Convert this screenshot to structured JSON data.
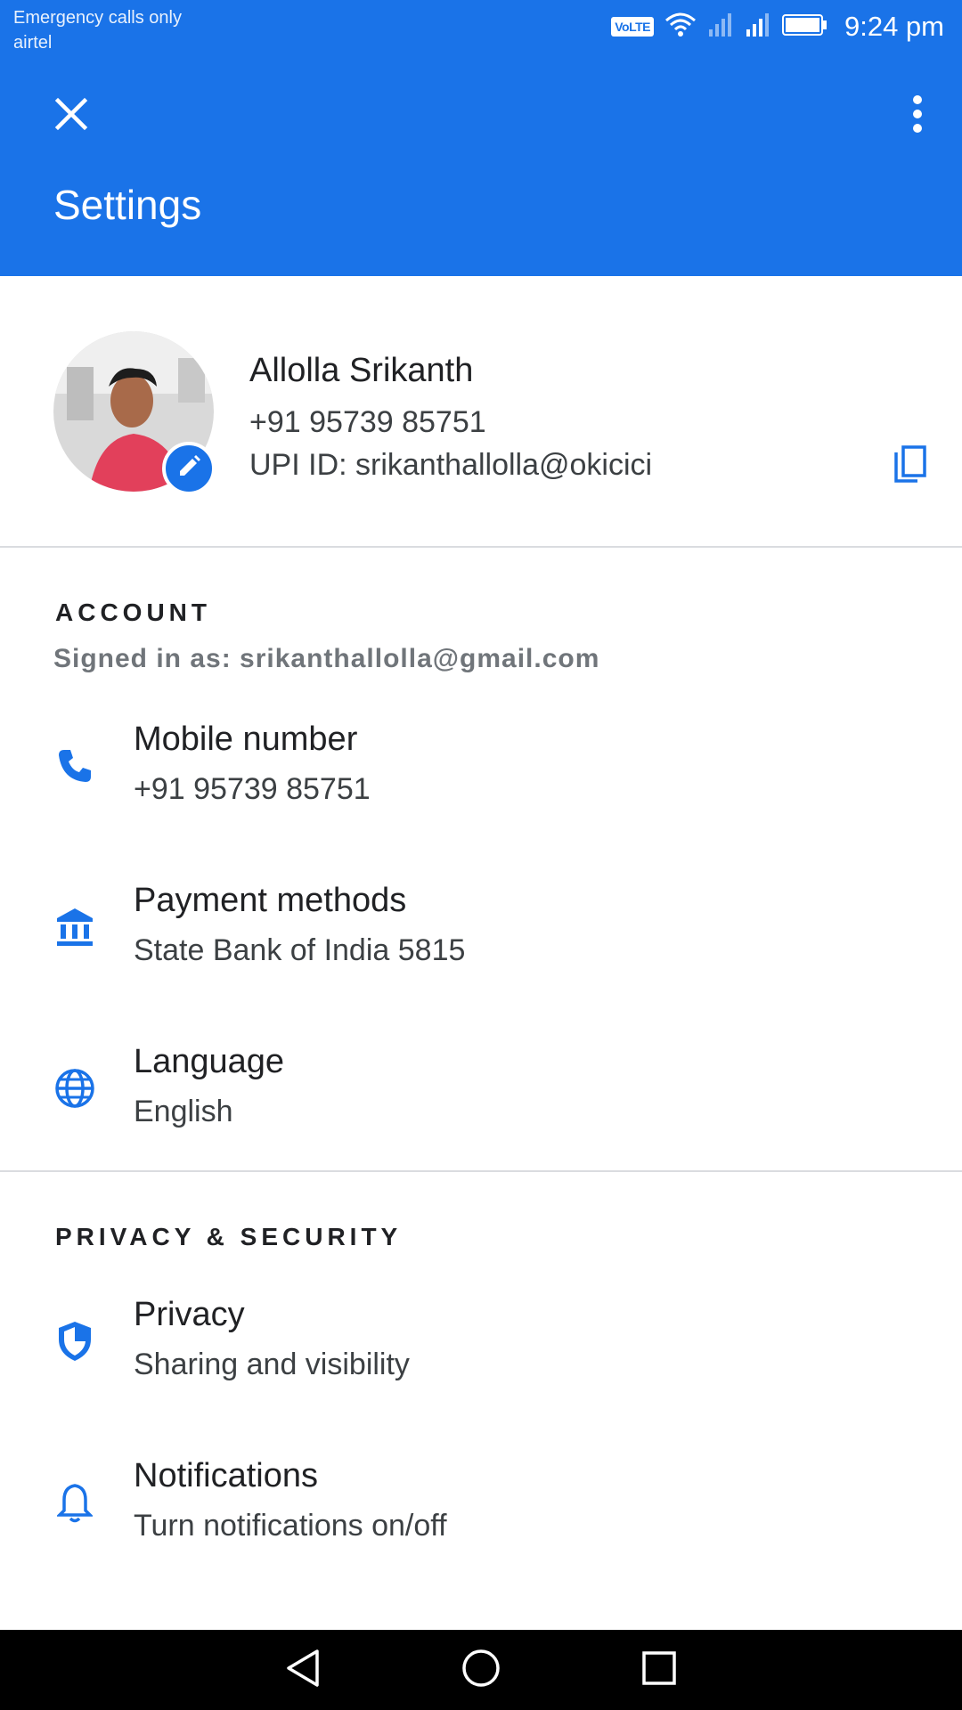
{
  "status_bar": {
    "carrier_line1": "Emergency calls only",
    "carrier_line2": "airtel",
    "volte_label": "VoLTE",
    "time": "9:24 pm"
  },
  "app_bar": {
    "title": "Settings",
    "close_icon": "close-icon",
    "more_icon": "more-vert-icon",
    "color": "#1a73e8"
  },
  "profile": {
    "name": "Allolla Srikanth",
    "phone": "+91 95739 85751",
    "upi": "UPI ID: srikanthallolla@okicici"
  },
  "account": {
    "header": "ACCOUNT",
    "signed_in": "Signed in as: srikanthallolla@gmail.com",
    "items": [
      {
        "icon": "phone-icon",
        "title": "Mobile number",
        "subtitle": "+91 95739 85751"
      },
      {
        "icon": "bank-icon",
        "title": "Payment methods",
        "subtitle": "State Bank of India 5815"
      },
      {
        "icon": "globe-icon",
        "title": "Language",
        "subtitle": "English"
      }
    ]
  },
  "privacy_security": {
    "header": "PRIVACY & SECURITY",
    "items": [
      {
        "icon": "shield-icon",
        "title": "Privacy",
        "subtitle": "Sharing and visibility"
      },
      {
        "icon": "bell-icon",
        "title": "Notifications",
        "subtitle": "Turn notifications on/off"
      }
    ]
  },
  "nav_bar": {
    "back_icon": "back-icon",
    "home_icon": "home-icon",
    "recents_icon": "recents-icon"
  }
}
